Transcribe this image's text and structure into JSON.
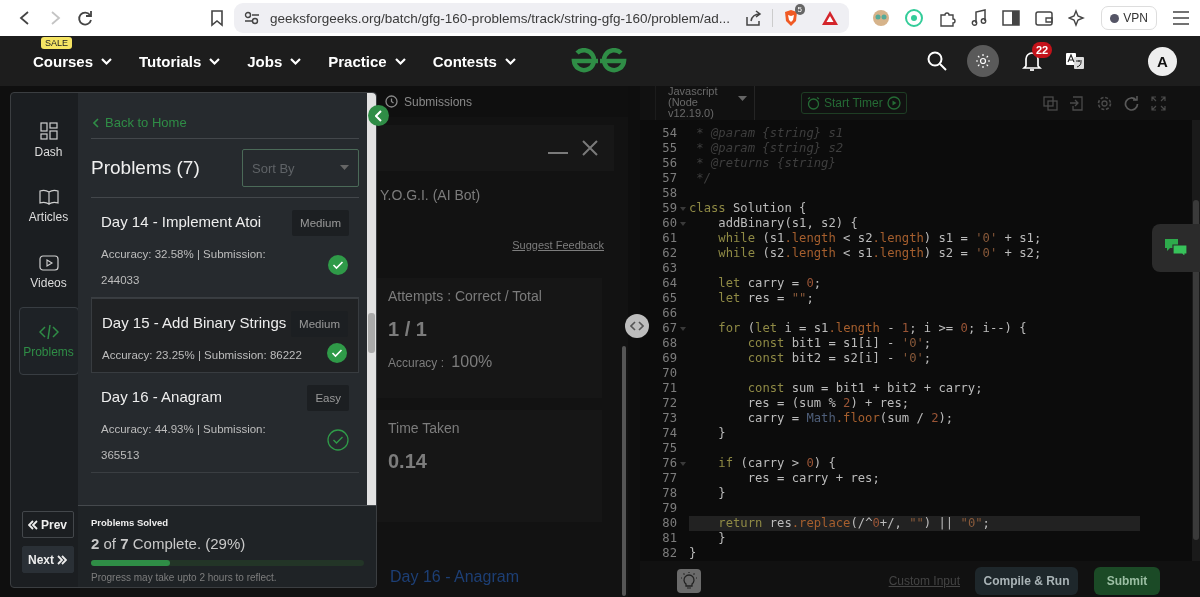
{
  "browser": {
    "forward_enabled": false,
    "url": "geeksforgeeks.org/batch/gfg-160-problems/track/string-gfg-160/problem/ad...",
    "extension_badge": "5",
    "vpn": "VPN"
  },
  "nav": {
    "items": [
      {
        "label": "Courses",
        "badge": "SALE"
      },
      {
        "label": "Tutorials"
      },
      {
        "label": "Jobs"
      },
      {
        "label": "Practice"
      },
      {
        "label": "Contests"
      }
    ],
    "notification_count": "22",
    "avatar": "A"
  },
  "middle": {
    "tab": "Submissions",
    "assistant": "Y.O.G.I. (AI Bot)",
    "feedback_link": "Suggest Feedback",
    "attempts": {
      "label": "Attempts : Correct / Total",
      "value": "1 / 1",
      "accuracy_label": "Accuracy :",
      "accuracy": "100%"
    },
    "time": {
      "label": "Time Taken",
      "value": "0.14"
    },
    "next_link": "Day 16 - Anagram"
  },
  "overlay": {
    "sidebar": [
      {
        "kind": "dash",
        "label": "Dash",
        "selected": false
      },
      {
        "kind": "articles",
        "label": "Articles",
        "selected": false
      },
      {
        "kind": "videos",
        "label": "Videos",
        "selected": false
      },
      {
        "kind": "problems",
        "label": "Problems",
        "selected": true
      }
    ],
    "prev": "Prev",
    "next": "Next",
    "back": "Back to Home",
    "heading": "Problems (7)",
    "sort": {
      "placeholder": "Sort By"
    },
    "problems": [
      {
        "title": "Day 14 - Implement Atoi",
        "difficulty": "Medium",
        "stats": "Accuracy: 32.58% | Submission: 244033",
        "solved": true,
        "selected": false
      },
      {
        "title": "Day 15 - Add Binary Strings",
        "difficulty": "Medium",
        "stats": "Accuracy: 23.25% | Submission: 86222",
        "solved": true,
        "selected": true
      },
      {
        "title": "Day 16 - Anagram",
        "difficulty": "Easy",
        "stats": "Accuracy: 44.93% | Submission: 365513",
        "solved": false,
        "selected": false
      }
    ],
    "progress": {
      "title": "Problems Solved",
      "summary": "**2** of **7** Complete. (29%)",
      "level": 0.29,
      "note": "Progress may take upto 2 hours to reflect."
    }
  },
  "editor": {
    "language": "Javascript (Node v12.19.0)",
    "timer": "Start Timer",
    "lines": [
      {
        "number": "54",
        "kind": "comment",
        "text": " * @param {string} s1",
        "fold": false,
        "active": false
      },
      {
        "number": "55",
        "kind": "comment",
        "text": " * @param {string} s2",
        "fold": false,
        "active": false
      },
      {
        "number": "56",
        "kind": "comment",
        "text": " * @returns {string}",
        "fold": false,
        "active": false
      },
      {
        "number": "57",
        "kind": "comment",
        "text": " */",
        "fold": false,
        "active": false
      },
      {
        "number": "58",
        "kind": "code",
        "fold": false,
        "active": false
      },
      {
        "number": "59",
        "kind": "code",
        "text": "class Solution {",
        "fold": true,
        "active": false
      },
      {
        "number": "60",
        "kind": "code",
        "text": "    addBinary(s1, s2) {",
        "fold": true,
        "active": false
      },
      {
        "number": "61",
        "kind": "code",
        "text": "    while (s1.length < s2.length) s1 = '0' + s1;",
        "fold": false,
        "active": false
      },
      {
        "number": "62",
        "kind": "code",
        "text": "    while (s2.length < s1.length) s2 = '0' + s2;",
        "fold": false,
        "active": false
      },
      {
        "number": "63",
        "kind": "code",
        "fold": false,
        "active": false
      },
      {
        "number": "64",
        "kind": "code",
        "text": "    let carry = 0;",
        "fold": false,
        "active": false
      },
      {
        "number": "65",
        "kind": "code",
        "text": "    let res = \"\";",
        "fold": false,
        "active": false
      },
      {
        "number": "66",
        "kind": "code",
        "fold": false,
        "active": false
      },
      {
        "number": "67",
        "kind": "code",
        "text": "    for (let i = s1.length - 1; i >= 0; i--) {",
        "fold": true,
        "active": false
      },
      {
        "number": "68",
        "kind": "code",
        "text": "        const bit1 = s1[i] - '0';",
        "fold": false,
        "active": false
      },
      {
        "number": "69",
        "kind": "code",
        "text": "        const bit2 = s2[i] - '0';",
        "fold": false,
        "active": false
      },
      {
        "number": "70",
        "kind": "code",
        "fold": false,
        "active": false
      },
      {
        "number": "71",
        "kind": "code",
        "text": "        const sum = bit1 + bit2 + carry;",
        "fold": false,
        "active": false
      },
      {
        "number": "72",
        "kind": "code",
        "text": "        res = (sum % 2) + res;",
        "fold": false,
        "active": false
      },
      {
        "number": "73",
        "kind": "code",
        "text": "        carry = Math.floor(sum / 2);",
        "fold": false,
        "active": false
      },
      {
        "number": "74",
        "kind": "code",
        "text": "    }",
        "fold": false,
        "active": false
      },
      {
        "number": "75",
        "kind": "code",
        "fold": false,
        "active": false
      },
      {
        "number": "76",
        "kind": "code",
        "text": "    if (carry > 0) {",
        "fold": true,
        "active": false
      },
      {
        "number": "77",
        "kind": "code",
        "text": "        res = carry + res;",
        "fold": false,
        "active": false
      },
      {
        "number": "78",
        "kind": "code",
        "text": "    }",
        "fold": false,
        "active": false
      },
      {
        "number": "79",
        "kind": "code",
        "fold": false,
        "active": false
      },
      {
        "number": "80",
        "kind": "code",
        "text": "    return res.replace(/^0+/, \"\") || \"0\";",
        "fold": false,
        "active": true
      },
      {
        "number": "81",
        "kind": "code",
        "text": "    }",
        "fold": false,
        "active": false
      },
      {
        "number": "82",
        "kind": "code",
        "text": "}",
        "fold": false,
        "active": false
      }
    ],
    "custom_input": "Custom Input",
    "run": "Compile & Run",
    "submit": "Submit"
  }
}
